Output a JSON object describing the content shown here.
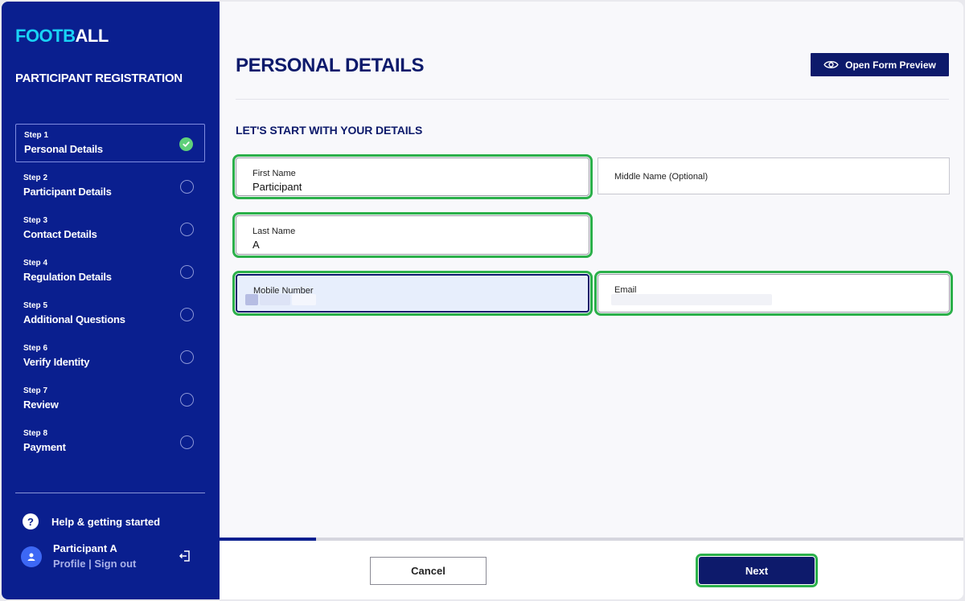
{
  "app": {
    "logo_part1": "FOOTB",
    "logo_part2": "ALL",
    "sidebar_title": "PARTICIPANT REGISTRATION"
  },
  "steps": [
    {
      "num": "Step 1",
      "label": "Personal Details",
      "status": "complete"
    },
    {
      "num": "Step 2",
      "label": "Participant Details",
      "status": "pending"
    },
    {
      "num": "Step 3",
      "label": "Contact Details",
      "status": "pending"
    },
    {
      "num": "Step 4",
      "label": "Regulation Details",
      "status": "pending"
    },
    {
      "num": "Step 5",
      "label": "Additional Questions",
      "status": "pending"
    },
    {
      "num": "Step 6",
      "label": "Verify Identity",
      "status": "pending"
    },
    {
      "num": "Step 7",
      "label": "Review",
      "status": "pending"
    },
    {
      "num": "Step 8",
      "label": "Payment",
      "status": "pending"
    }
  ],
  "help": {
    "label": "Help & getting started"
  },
  "user": {
    "name": "Participant A",
    "profile_link": "Profile",
    "separator": "|",
    "signout_link": "Sign out"
  },
  "main": {
    "title": "PERSONAL DETAILS",
    "preview_button": "Open Form Preview",
    "section_title": "LET'S START WITH YOUR DETAILS"
  },
  "form": {
    "first_name": {
      "label": "First Name",
      "value": "Participant"
    },
    "middle_name": {
      "label": "Middle Name (Optional)",
      "value": ""
    },
    "last_name": {
      "label": "Last Name",
      "value": "A"
    },
    "mobile": {
      "label": "Mobile Number",
      "value": ""
    },
    "email": {
      "label": "Email",
      "value": ""
    }
  },
  "progress": {
    "fraction": 0.13
  },
  "footer": {
    "cancel_label": "Cancel",
    "next_label": "Next"
  },
  "colors": {
    "sidebar": "#0a1f8f",
    "navy": "#0d1a6b",
    "highlight": "#2bb04a",
    "check": "#5fd07a",
    "logo_accent": "#19d3f5"
  }
}
